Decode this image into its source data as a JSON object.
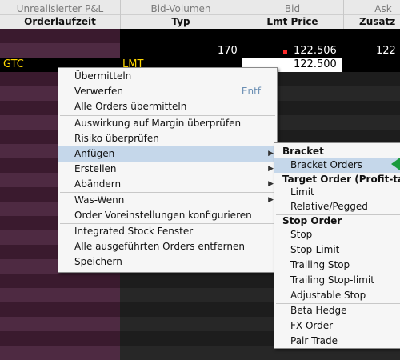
{
  "header": {
    "col1": {
      "top": "Unrealisierter P&L",
      "bottom": "Orderlaufzeit"
    },
    "col2": {
      "top": "Bid-Volumen",
      "bottom": "Typ"
    },
    "col3": {
      "top": "Bid",
      "bottom": "Lmt Price"
    },
    "col4": {
      "top": "Ask",
      "bottom": "Zusatz"
    }
  },
  "quote_row": {
    "bid_size": "170",
    "bid": "122.506",
    "ask": "122"
  },
  "order_row": {
    "tif": "GTC",
    "type": "LMT",
    "limit_price": "122.500"
  },
  "context_menu": {
    "items": [
      {
        "label": "Übermitteln"
      },
      {
        "label": "Verwerfen",
        "shortcut": "Entf"
      },
      {
        "label": "Alle Orders übermitteln"
      },
      {
        "label": "Auswirkung auf Margin überprüfen"
      },
      {
        "label": "Risiko überprüfen"
      },
      {
        "label": "Anfügen"
      },
      {
        "label": "Erstellen"
      },
      {
        "label": "Abändern"
      },
      {
        "label": "Was-Wenn"
      },
      {
        "label": "Order Voreinstellungen konfigurieren"
      },
      {
        "label": "Integrated Stock Fenster"
      },
      {
        "label": "Alle ausgeführten Orders entfernen"
      },
      {
        "label": "Speichern"
      }
    ]
  },
  "submenu": {
    "section_bracket": "Bracket",
    "bracket_orders": "Bracket Orders",
    "section_target": "Target Order (Profit-ta",
    "limit": "Limit",
    "relative_pegged": "Relative/Pegged",
    "section_stop": "Stop Order",
    "stop": "Stop",
    "stop_limit": "Stop-Limit",
    "trailing_stop": "Trailing Stop",
    "trailing_stop_limit": "Trailing Stop-limit",
    "adjustable_stop": "Adjustable Stop",
    "beta_hedge": "Beta Hedge",
    "fx_order": "FX Order",
    "pair_trade": "Pair Trade"
  },
  "colors": {
    "left_column": "#3a1a2e",
    "left_column_alt": "#4e2a42",
    "order_text": "#ffd700",
    "menu_bg": "#f6f6f6",
    "highlight": "#c5d7ea",
    "active_marker": "#1a9a3c"
  }
}
